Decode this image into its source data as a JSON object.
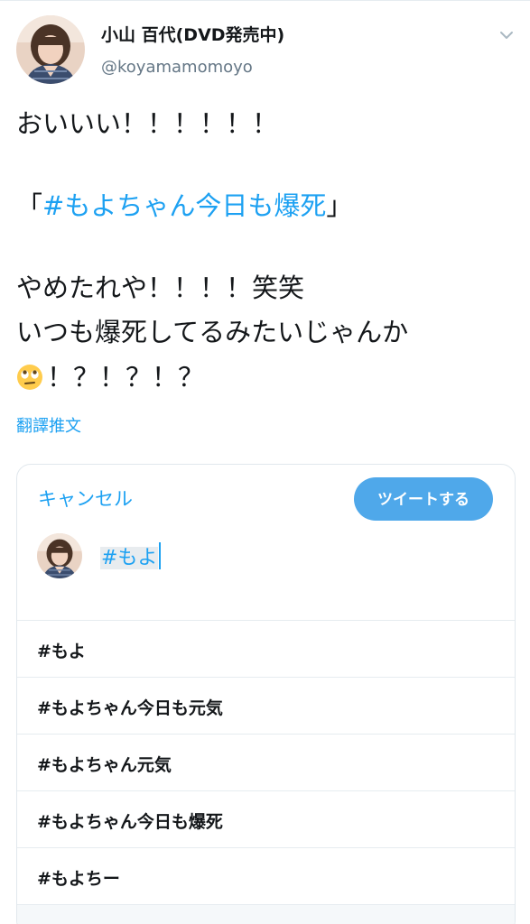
{
  "tweet": {
    "author": {
      "display_name": "小山 百代(DVD発売中)",
      "handle": "@koyamamomoyo"
    },
    "menu_icon": "chevron-down-icon",
    "lines": {
      "line1": "おいいい！！！！！！",
      "hashtag_open": "「",
      "hashtag": "#もよちゃん今日も爆死",
      "hashtag_close": "」",
      "line3": "やめたれや！！！！笑笑",
      "line4": "いつも爆死してるみたいじゃんか",
      "line5_emoji": "face-with-rolling-eyes-emoji",
      "line5_text": "！？！？！？"
    },
    "translate_label": "翻譯推文"
  },
  "composer": {
    "cancel_label": "キャンセル",
    "tweet_button_label": "ツイートする",
    "input_value": "#もよ",
    "suggestions": [
      "#もよ",
      "#もよちゃん今日も元気",
      "#もよちゃん元気",
      "#もよちゃん今日も爆死",
      "#もよちー"
    ]
  },
  "colors": {
    "accent": "#1da1f2",
    "button": "#4fa8ea",
    "text": "#14171a",
    "muted": "#657786",
    "divider": "#e6ecf0"
  }
}
